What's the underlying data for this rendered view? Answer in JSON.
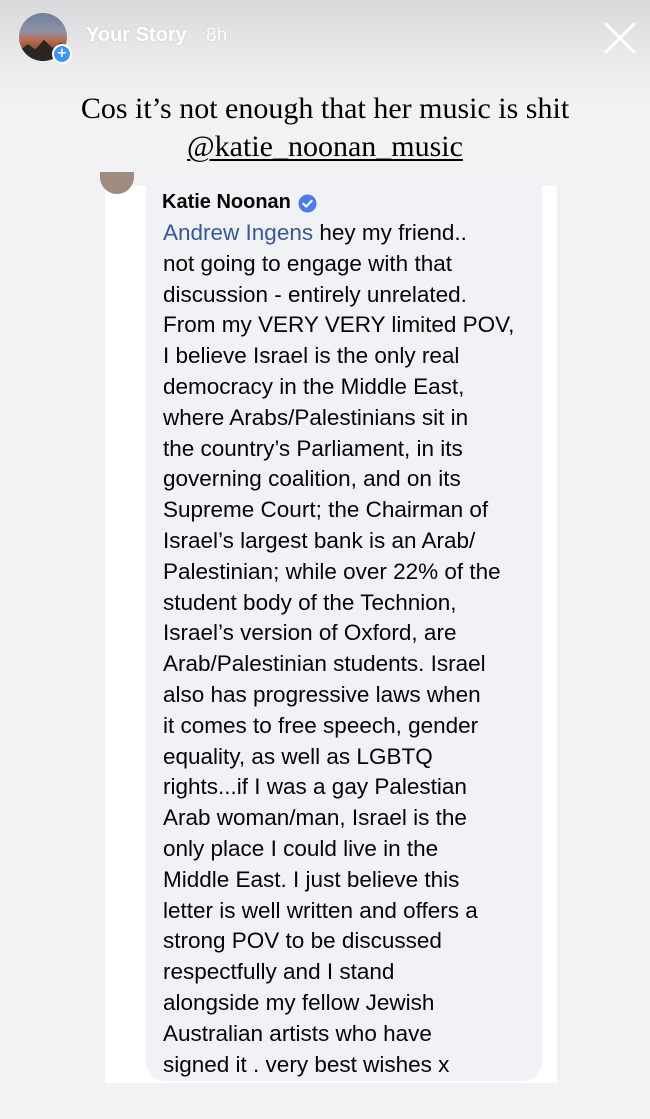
{
  "story": {
    "label": "Your Story",
    "time": "8h",
    "avatar_icon": "profile-avatar",
    "add_icon": "plus-icon",
    "close_icon": "close-icon"
  },
  "caption": {
    "line1": "Cos it’s not enough that her music is shit",
    "mention": "@katie_noonan_music"
  },
  "comment": {
    "author": "Katie Noonan",
    "verified_icon": "verified-badge-icon",
    "tagged_user": "Andrew Ingens",
    "lines": [
      " hey my friend..",
      "not going to engage with that",
      "discussion - entirely unrelated.",
      "From my VERY VERY limited POV,",
      "I believe Israel is the only real",
      "democracy in the Middle East,",
      "where Arabs/Palestinians sit in",
      "the country’s Parliament, in its",
      "governing coalition, and on its",
      "Supreme Court; the Chairman of",
      "Israel’s largest bank is an Arab/",
      "Palestinian; while over 22% of the",
      "student body of the Technion,",
      "Israel’s version of Oxford, are",
      "Arab/Palestinian students. Israel",
      "also has progressive laws when",
      "it comes to free speech, gender",
      "equality, as well as LGBTQ",
      "rights...if I was a gay Palestian",
      "Arab woman/man, Israel is the",
      "only place I could live in the",
      "Middle East. I just believe this",
      "letter is well written and offers a",
      "strong POV to be discussed",
      "respectfully and I stand",
      "alongside my fellow Jewish",
      "Australian artists who have",
      "signed it . very best wishes x"
    ]
  },
  "colors": {
    "link": "#385898",
    "verified": "#4c7ce6",
    "bubble": "#f0f2f5",
    "background": "#f2f2f4",
    "story_add": "#3e95f3"
  }
}
